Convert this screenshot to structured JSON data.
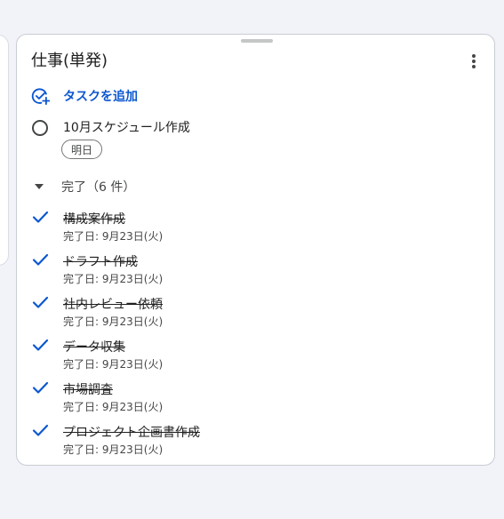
{
  "list": {
    "title": "仕事(単発)",
    "add_task_label": "タスクを追加"
  },
  "pending_task": {
    "title": "10月スケジュール作成",
    "due_chip": "明日"
  },
  "completed": {
    "header": "完了（6 件）",
    "items": [
      {
        "title": "構成案作成",
        "date": "完了日: 9月23日(火)"
      },
      {
        "title": "ドラフト作成",
        "date": "完了日: 9月23日(火)"
      },
      {
        "title": "社内レビュー依頼",
        "date": "完了日: 9月23日(火)"
      },
      {
        "title": "データ収集",
        "date": "完了日: 9月23日(火)"
      },
      {
        "title": "市場調査",
        "date": "完了日: 9月23日(火)"
      },
      {
        "title": "プロジェクト企画書作成",
        "date": "完了日: 9月23日(火)"
      }
    ]
  },
  "icons": {
    "more": "more-vert-icon",
    "add_task": "add-task-icon",
    "caret": "caret-down-icon",
    "check": "check-icon"
  },
  "colors": {
    "accent": "#0b57d0",
    "background": "#f1f3f9"
  }
}
